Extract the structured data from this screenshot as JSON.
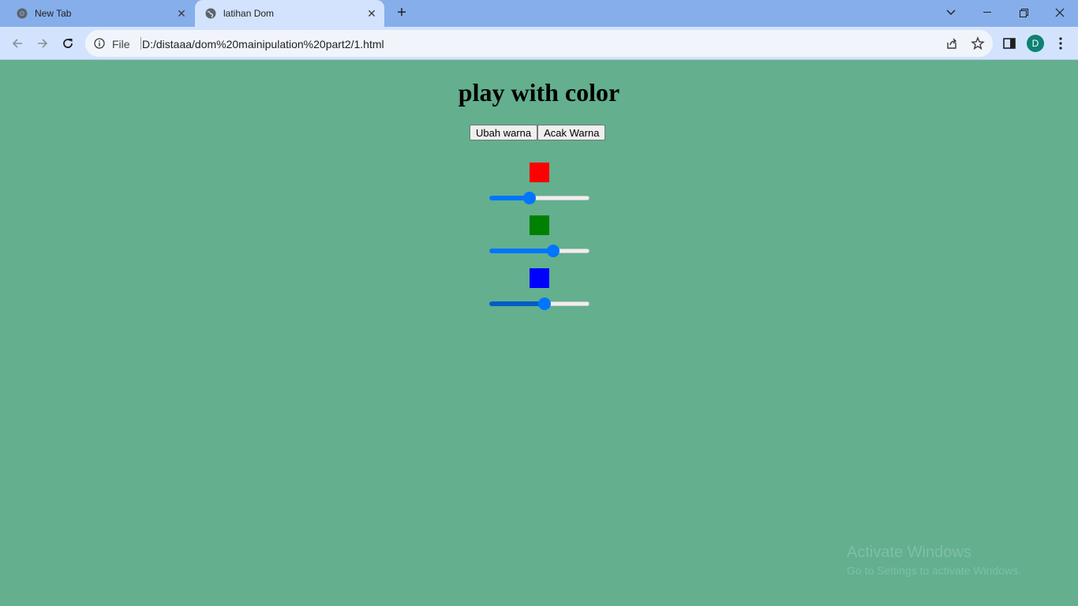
{
  "browser": {
    "tabs": [
      {
        "title": "New Tab",
        "active": false
      },
      {
        "title": "latihan Dom",
        "active": true
      }
    ],
    "address_bar": {
      "scheme_label": "File",
      "url": "D:/distaaa/dom%20mainipulation%20part2/1.html"
    },
    "profile_initial": "D"
  },
  "page": {
    "heading": "play with color",
    "buttons": {
      "change_color": "Ubah warna",
      "random_color": "Acak Warna"
    },
    "sliders": [
      {
        "name": "red",
        "swatch_color": "#ff0000",
        "level": 0.39
      },
      {
        "name": "green",
        "swatch_color": "#008000",
        "level": 0.66
      },
      {
        "name": "blue",
        "swatch_color": "#0000ff",
        "level": 0.56
      }
    ],
    "background_color": "#63af8e"
  },
  "watermark": {
    "title": "Activate Windows",
    "subtitle": "Go to Settings to activate Windows."
  }
}
